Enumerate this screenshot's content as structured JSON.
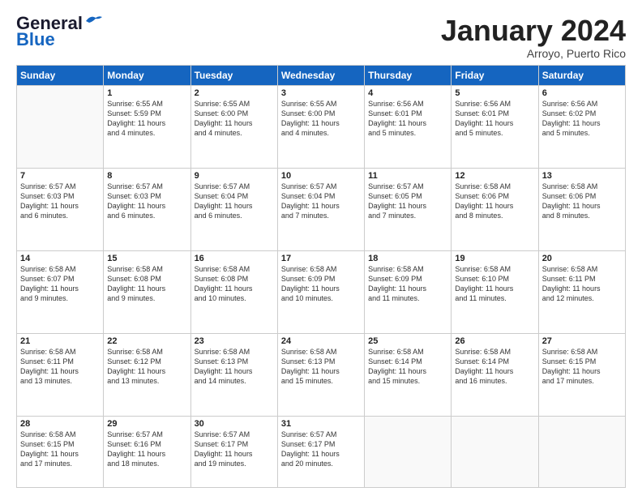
{
  "header": {
    "logo_line1": "General",
    "logo_line2": "Blue",
    "month": "January 2024",
    "location": "Arroyo, Puerto Rico"
  },
  "days_of_week": [
    "Sunday",
    "Monday",
    "Tuesday",
    "Wednesday",
    "Thursday",
    "Friday",
    "Saturday"
  ],
  "weeks": [
    [
      {
        "day": "",
        "info": ""
      },
      {
        "day": "1",
        "info": "Sunrise: 6:55 AM\nSunset: 5:59 PM\nDaylight: 11 hours\nand 4 minutes."
      },
      {
        "day": "2",
        "info": "Sunrise: 6:55 AM\nSunset: 6:00 PM\nDaylight: 11 hours\nand 4 minutes."
      },
      {
        "day": "3",
        "info": "Sunrise: 6:55 AM\nSunset: 6:00 PM\nDaylight: 11 hours\nand 4 minutes."
      },
      {
        "day": "4",
        "info": "Sunrise: 6:56 AM\nSunset: 6:01 PM\nDaylight: 11 hours\nand 5 minutes."
      },
      {
        "day": "5",
        "info": "Sunrise: 6:56 AM\nSunset: 6:01 PM\nDaylight: 11 hours\nand 5 minutes."
      },
      {
        "day": "6",
        "info": "Sunrise: 6:56 AM\nSunset: 6:02 PM\nDaylight: 11 hours\nand 5 minutes."
      }
    ],
    [
      {
        "day": "7",
        "info": "Sunrise: 6:57 AM\nSunset: 6:03 PM\nDaylight: 11 hours\nand 6 minutes."
      },
      {
        "day": "8",
        "info": "Sunrise: 6:57 AM\nSunset: 6:03 PM\nDaylight: 11 hours\nand 6 minutes."
      },
      {
        "day": "9",
        "info": "Sunrise: 6:57 AM\nSunset: 6:04 PM\nDaylight: 11 hours\nand 6 minutes."
      },
      {
        "day": "10",
        "info": "Sunrise: 6:57 AM\nSunset: 6:04 PM\nDaylight: 11 hours\nand 7 minutes."
      },
      {
        "day": "11",
        "info": "Sunrise: 6:57 AM\nSunset: 6:05 PM\nDaylight: 11 hours\nand 7 minutes."
      },
      {
        "day": "12",
        "info": "Sunrise: 6:58 AM\nSunset: 6:06 PM\nDaylight: 11 hours\nand 8 minutes."
      },
      {
        "day": "13",
        "info": "Sunrise: 6:58 AM\nSunset: 6:06 PM\nDaylight: 11 hours\nand 8 minutes."
      }
    ],
    [
      {
        "day": "14",
        "info": "Sunrise: 6:58 AM\nSunset: 6:07 PM\nDaylight: 11 hours\nand 9 minutes."
      },
      {
        "day": "15",
        "info": "Sunrise: 6:58 AM\nSunset: 6:08 PM\nDaylight: 11 hours\nand 9 minutes."
      },
      {
        "day": "16",
        "info": "Sunrise: 6:58 AM\nSunset: 6:08 PM\nDaylight: 11 hours\nand 10 minutes."
      },
      {
        "day": "17",
        "info": "Sunrise: 6:58 AM\nSunset: 6:09 PM\nDaylight: 11 hours\nand 10 minutes."
      },
      {
        "day": "18",
        "info": "Sunrise: 6:58 AM\nSunset: 6:09 PM\nDaylight: 11 hours\nand 11 minutes."
      },
      {
        "day": "19",
        "info": "Sunrise: 6:58 AM\nSunset: 6:10 PM\nDaylight: 11 hours\nand 11 minutes."
      },
      {
        "day": "20",
        "info": "Sunrise: 6:58 AM\nSunset: 6:11 PM\nDaylight: 11 hours\nand 12 minutes."
      }
    ],
    [
      {
        "day": "21",
        "info": "Sunrise: 6:58 AM\nSunset: 6:11 PM\nDaylight: 11 hours\nand 13 minutes."
      },
      {
        "day": "22",
        "info": "Sunrise: 6:58 AM\nSunset: 6:12 PM\nDaylight: 11 hours\nand 13 minutes."
      },
      {
        "day": "23",
        "info": "Sunrise: 6:58 AM\nSunset: 6:13 PM\nDaylight: 11 hours\nand 14 minutes."
      },
      {
        "day": "24",
        "info": "Sunrise: 6:58 AM\nSunset: 6:13 PM\nDaylight: 11 hours\nand 15 minutes."
      },
      {
        "day": "25",
        "info": "Sunrise: 6:58 AM\nSunset: 6:14 PM\nDaylight: 11 hours\nand 15 minutes."
      },
      {
        "day": "26",
        "info": "Sunrise: 6:58 AM\nSunset: 6:14 PM\nDaylight: 11 hours\nand 16 minutes."
      },
      {
        "day": "27",
        "info": "Sunrise: 6:58 AM\nSunset: 6:15 PM\nDaylight: 11 hours\nand 17 minutes."
      }
    ],
    [
      {
        "day": "28",
        "info": "Sunrise: 6:58 AM\nSunset: 6:15 PM\nDaylight: 11 hours\nand 17 minutes."
      },
      {
        "day": "29",
        "info": "Sunrise: 6:57 AM\nSunset: 6:16 PM\nDaylight: 11 hours\nand 18 minutes."
      },
      {
        "day": "30",
        "info": "Sunrise: 6:57 AM\nSunset: 6:17 PM\nDaylight: 11 hours\nand 19 minutes."
      },
      {
        "day": "31",
        "info": "Sunrise: 6:57 AM\nSunset: 6:17 PM\nDaylight: 11 hours\nand 20 minutes."
      },
      {
        "day": "",
        "info": ""
      },
      {
        "day": "",
        "info": ""
      },
      {
        "day": "",
        "info": ""
      }
    ]
  ]
}
